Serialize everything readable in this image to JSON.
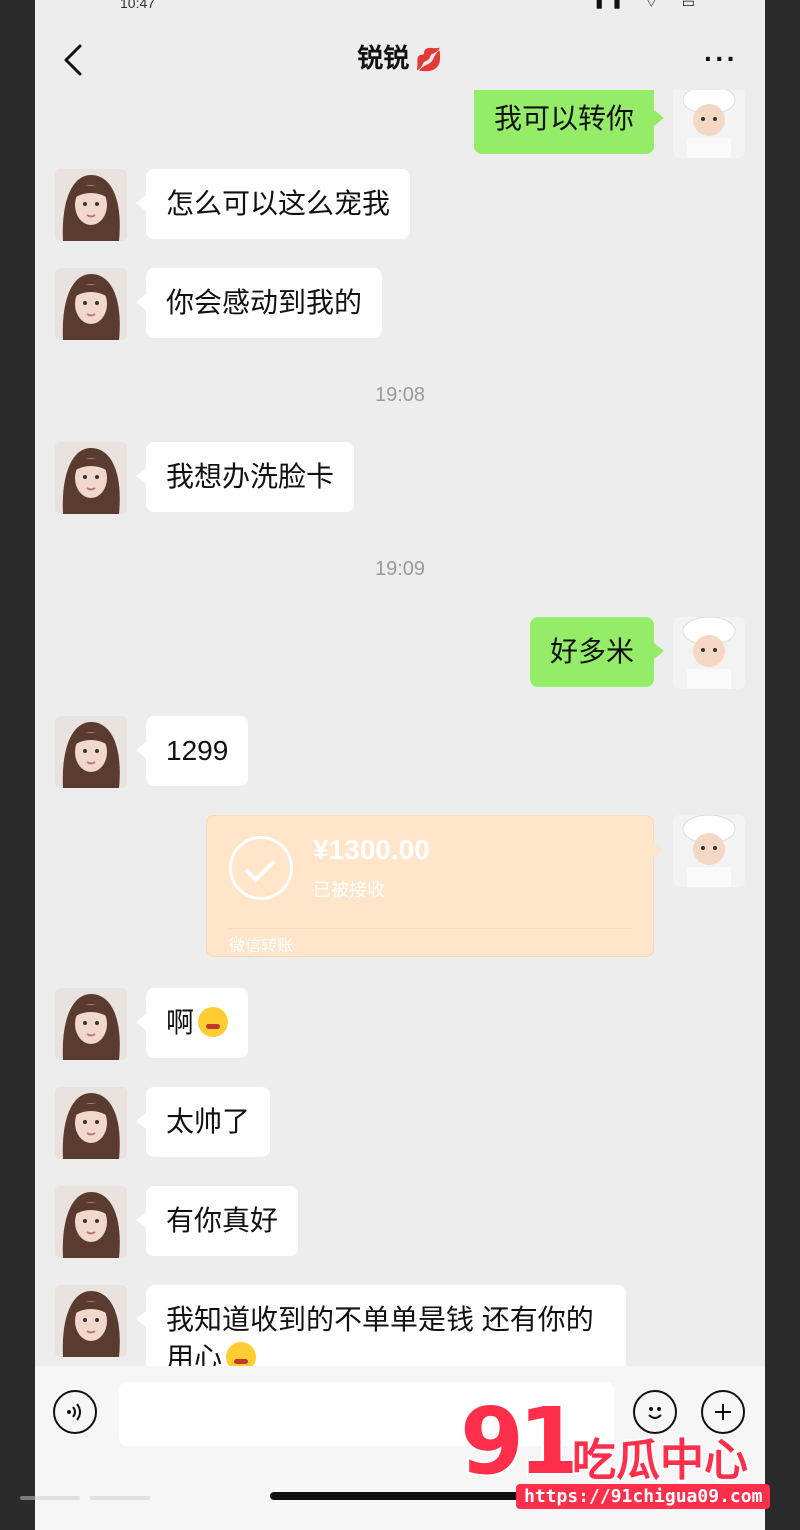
{
  "status_bar": {
    "time": "10:47",
    "icons_text": "▮▮ ⌔ ▭"
  },
  "header": {
    "title": "锐锐",
    "title_emoji": "💋",
    "more_label": "···"
  },
  "messages": [
    {
      "type": "out",
      "text": "我可以转你"
    },
    {
      "type": "in",
      "text": "怎么可以这么宠我"
    },
    {
      "type": "in",
      "text": "你会感动到我的"
    },
    {
      "type": "time",
      "text": "19:08"
    },
    {
      "type": "in",
      "text": "我想办洗脸卡"
    },
    {
      "type": "time",
      "text": "19:09"
    },
    {
      "type": "out",
      "text": "好多米"
    },
    {
      "type": "in",
      "text": "1299"
    },
    {
      "type": "transfer",
      "amount": "¥1300.00",
      "status": "已被接收",
      "label": "微信转账"
    },
    {
      "type": "in",
      "text": "啊",
      "emoji": "shushing-face"
    },
    {
      "type": "in",
      "text": "太帅了"
    },
    {
      "type": "in",
      "text": "有你真好"
    },
    {
      "type": "in",
      "text": "我知道收到的不单单是钱 还有你的用心",
      "emoji": "angry-face"
    }
  ],
  "input": {
    "placeholder": "",
    "value": ""
  },
  "icons": {
    "back": "chevron-left-icon",
    "more": "more-icon",
    "voice": "voice-icon",
    "emoji": "emoji-icon",
    "plus": "plus-icon"
  },
  "watermark": {
    "number": "91",
    "brand": "吃瓜中心",
    "url": "https://91chigua09.com"
  },
  "colors": {
    "bubble_out": "#95ec69",
    "bubble_in": "#ffffff",
    "transfer": "#ffe5c9",
    "watermark": "#ff2f4c"
  }
}
